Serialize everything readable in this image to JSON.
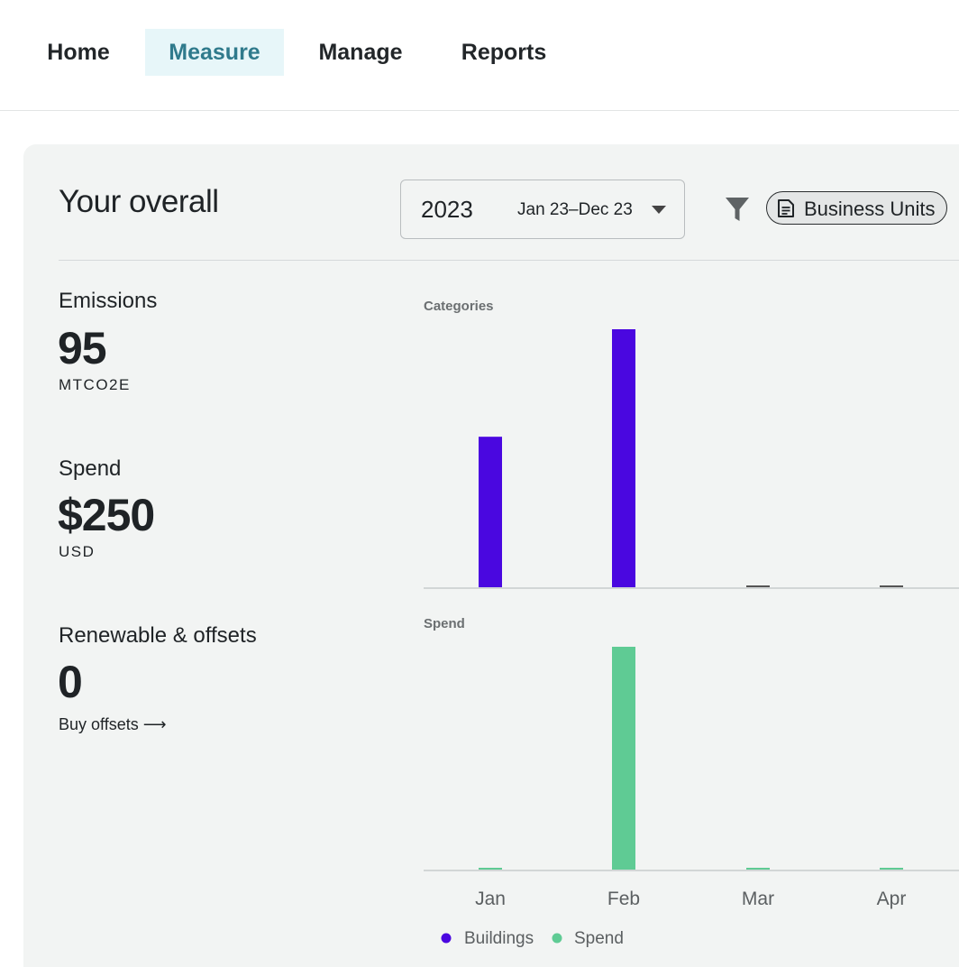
{
  "nav": {
    "tabs": [
      {
        "label": "Home"
      },
      {
        "label": "Measure"
      },
      {
        "label": "Manage"
      },
      {
        "label": "Reports"
      }
    ],
    "active": "Measure"
  },
  "header": {
    "title": "Your overall",
    "date_year": "2023",
    "date_range": "Jan 23–Dec 23",
    "chip_label": "Business Units",
    "filter_icon": "filter-funnel-icon",
    "chip_icon": "document-icon"
  },
  "metrics": {
    "emissions": {
      "label": "Emissions",
      "value": "95",
      "unit": "MTCO2E"
    },
    "spend": {
      "label": "Spend",
      "value": "$250",
      "unit": "USD"
    },
    "renewable": {
      "label": "Renewable & offsets",
      "value": "0",
      "link": "Buy offsets ⟶"
    }
  },
  "colors": {
    "buildings": "#4a07e0",
    "spend": "#5fcb94",
    "active_tab_bg": "#e7f6f9",
    "active_tab_text": "#2f7a8c"
  },
  "chart_data": [
    {
      "type": "bar",
      "title": "Categories",
      "categories": [
        "Jan",
        "Feb",
        "Mar",
        "Apr"
      ],
      "series": [
        {
          "name": "Buildings",
          "values": [
            35,
            60,
            0,
            0
          ]
        }
      ],
      "ylim": [
        0,
        60
      ],
      "grid": false
    },
    {
      "type": "bar",
      "title": "Spend",
      "categories": [
        "Jan",
        "Feb",
        "Mar",
        "Apr"
      ],
      "series": [
        {
          "name": "Spend",
          "values": [
            1,
            250,
            1,
            1
          ]
        }
      ],
      "ylim": [
        0,
        250
      ],
      "grid": false
    }
  ],
  "legend": [
    {
      "name": "Buildings"
    },
    {
      "name": "Spend"
    }
  ]
}
